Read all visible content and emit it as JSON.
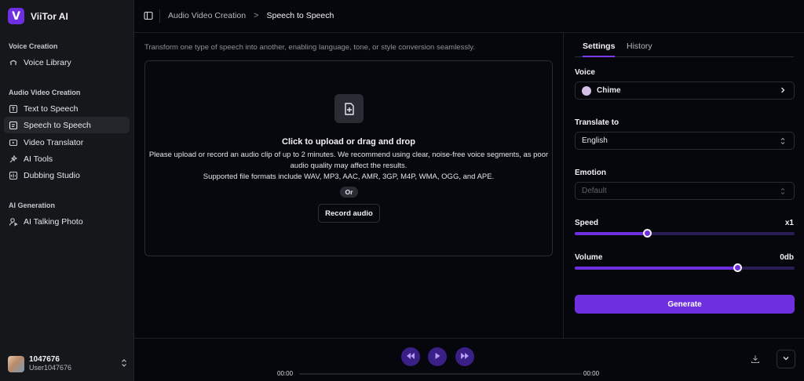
{
  "app": {
    "name": "ViiTor AI",
    "logo_letter": "V"
  },
  "sidebar": {
    "sections": [
      {
        "label": "Voice Creation"
      },
      {
        "label": "Audio Video Creation"
      },
      {
        "label": "AI Generation"
      }
    ],
    "items": [
      {
        "label": "Voice Library",
        "icon": "voice-library-icon"
      },
      {
        "label": "Text to Speech",
        "icon": "text-to-speech-icon"
      },
      {
        "label": "Speech to Speech",
        "icon": "speech-to-speech-icon",
        "active": true
      },
      {
        "label": "Video Translator",
        "icon": "video-translator-icon"
      },
      {
        "label": "AI Tools",
        "icon": "ai-tools-icon"
      },
      {
        "label": "Dubbing Studio",
        "icon": "dubbing-studio-icon"
      },
      {
        "label": "AI Talking Photo",
        "icon": "talking-photo-icon"
      }
    ],
    "user": {
      "id": "1047676",
      "name": "User1047676"
    }
  },
  "header": {
    "breadcrumb": [
      {
        "label": "Audio Video Creation"
      },
      {
        "label": "Speech to Speech"
      }
    ],
    "separator": ">"
  },
  "main": {
    "description": "Transform one type of speech into another, enabling language, tone, or style conversion seamlessly.",
    "upload": {
      "title": "Click to upload or drag and drop",
      "line1": "Please upload or record an audio clip of up to 2 minutes. We recommend using clear, noise-free voice segments, as poor",
      "line2": "audio quality may affect the results.",
      "line3": "Supported file formats include WAV, MP3, AAC, AMR, 3GP, M4P, WMA, OGG, and APE.",
      "or": "Or",
      "record_label": "Record audio"
    }
  },
  "settings": {
    "tabs": [
      {
        "label": "Settings",
        "active": true
      },
      {
        "label": "History"
      }
    ],
    "voice": {
      "label": "Voice",
      "value": "Chime",
      "dot_color": "#d6bfe8"
    },
    "translate": {
      "label": "Translate to",
      "value": "English"
    },
    "emotion": {
      "label": "Emotion",
      "value": "Default",
      "disabled": true
    },
    "speed": {
      "label": "Speed",
      "display": "x1",
      "fraction": 0.33
    },
    "volume": {
      "label": "Volume",
      "display": "0db",
      "fraction": 0.74
    },
    "generate_label": "Generate"
  },
  "player": {
    "current_time": "00:00",
    "total_time": "00:00",
    "progress": 0
  },
  "colors": {
    "accent": "#6d2fe0",
    "background": "#06070d",
    "sidebar": "#16171b"
  }
}
